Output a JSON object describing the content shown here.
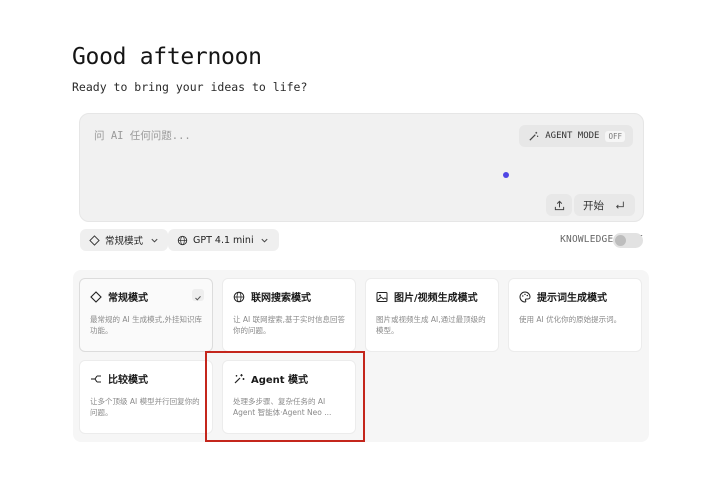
{
  "header": {
    "greeting": "Good afternoon",
    "subtitle": "Ready to bring your ideas to life?"
  },
  "prompt": {
    "placeholder": "问 AI 任何问题...",
    "agent_mode_label": "AGENT MODE",
    "agent_mode_state": "OFF",
    "start_label": "开始",
    "start_icon": "enter-icon",
    "upload_icon": "upload-icon"
  },
  "toolbar": {
    "mode_label": "常规模式",
    "model_label": "GPT 4.1 mini",
    "knowledge_base_label": "KNOWLEDGE BASE",
    "knowledge_base_on": false
  },
  "modes": [
    {
      "title": "常规模式",
      "desc": "最常规的 AI 生成模式,外挂知识库功能。",
      "icon": "diamond-icon",
      "selected": true
    },
    {
      "title": "联网搜索模式",
      "desc": "让 AI 联网搜索,基于实时信息回答你的问题。",
      "icon": "globe-icon",
      "selected": false
    },
    {
      "title": "图片/视频生成模式",
      "desc": "图片或视频生成 AI,通过最顶级的模型。",
      "icon": "image-icon",
      "selected": false
    },
    {
      "title": "提示词生成模式",
      "desc": "使用 AI 优化你的原始提示词。",
      "icon": "palette-icon",
      "selected": false
    },
    {
      "title": "比较模式",
      "desc": "让多个顶级 AI 模型并行回复你的问题。",
      "icon": "compare-icon",
      "selected": false
    },
    {
      "title": "Agent 模式",
      "desc": "处理多步骤、复杂任务的 AI Agent 智能体·Agent Neo ...",
      "icon": "sparkle-icon",
      "selected": false
    }
  ],
  "colors": {
    "accent_dot": "#4f46e5",
    "highlight_border": "#c4261c"
  }
}
